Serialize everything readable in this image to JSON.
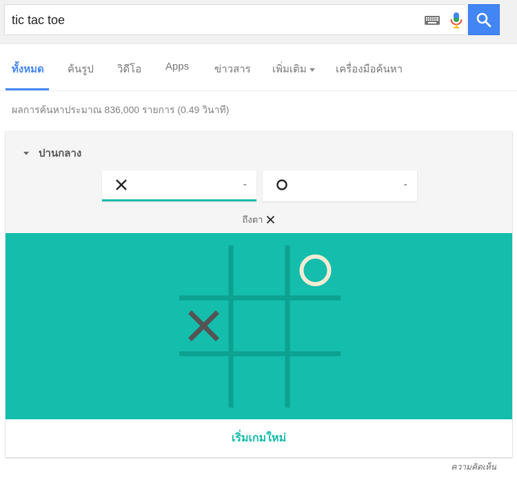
{
  "search": {
    "query": "tic tac toe",
    "icons": [
      "keyboard-icon",
      "mic-icon",
      "search-icon"
    ],
    "search_button_color": "#4285f4"
  },
  "tabs": {
    "items": [
      {
        "label": "ทั้งหมด",
        "active": true
      },
      {
        "label": "ค้นรูป",
        "active": false
      },
      {
        "label": "วิดีโอ",
        "active": false
      },
      {
        "label": "Apps",
        "active": false
      },
      {
        "label": "ข่าวสาร",
        "active": false
      },
      {
        "label": "เพิ่มเติม",
        "active": false
      },
      {
        "label": "เครื่องมือค้นหา",
        "active": false
      }
    ]
  },
  "result_stats": "ผลการค้นหาประมาณ 836,000 รายการ (0.49 วินาที)",
  "game": {
    "difficulty": "ปานกลาง",
    "players": [
      {
        "symbol": "X",
        "score": "-",
        "active": true
      },
      {
        "symbol": "O",
        "score": "-",
        "active": false
      }
    ],
    "turn_label": "ถึงตา",
    "turn_symbol": "X",
    "board": [
      [
        "",
        "",
        "O"
      ],
      [
        "X",
        "",
        ""
      ],
      [
        "",
        "",
        ""
      ]
    ],
    "board_color": "#14bdac",
    "line_color": "#0da192",
    "x_color": "#545454",
    "o_color": "#f2ebd3",
    "restart_label": "เริ่มเกมใหม่"
  },
  "feedback_label": "ความคิดเห็น"
}
